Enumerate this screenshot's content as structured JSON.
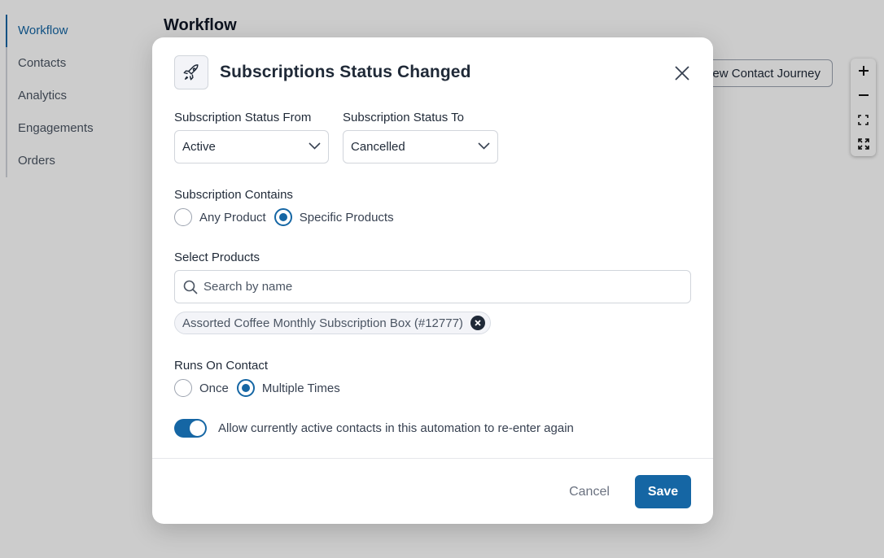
{
  "sidebar": {
    "items": [
      {
        "label": "Workflow",
        "active": true
      },
      {
        "label": "Contacts"
      },
      {
        "label": "Analytics"
      },
      {
        "label": "Engagements"
      },
      {
        "label": "Orders"
      }
    ]
  },
  "header": {
    "title": "Workflow",
    "journey_button": "View Contact Journey"
  },
  "zoom_controls": {
    "icons": [
      "plus-icon",
      "minus-icon",
      "fit-screen-icon",
      "fullscreen-icon"
    ]
  },
  "modal": {
    "icon": "rocket-icon",
    "title": "Subscriptions Status Changed",
    "status_from": {
      "label": "Subscription Status From",
      "value": "Active"
    },
    "status_to": {
      "label": "Subscription Status To",
      "value": "Cancelled"
    },
    "contains": {
      "label": "Subscription Contains",
      "options": [
        {
          "label": "Any Product",
          "checked": false
        },
        {
          "label": "Specific Products",
          "checked": true
        }
      ]
    },
    "products": {
      "label": "Select Products",
      "placeholder": "Search by name",
      "selected": [
        "Assorted Coffee Monthly Subscription Box (#12777)"
      ]
    },
    "runs_on": {
      "label": "Runs On Contact",
      "options": [
        {
          "label": "Once",
          "checked": false
        },
        {
          "label": "Multiple Times",
          "checked": true
        }
      ]
    },
    "reenter": {
      "label": "Allow currently active contacts in this automation to re-enter again",
      "enabled": true
    },
    "cancel_label": "Cancel",
    "save_label": "Save"
  },
  "colors": {
    "accent": "#1566a4",
    "overlay": "rgba(0,0,0,0.2)"
  }
}
